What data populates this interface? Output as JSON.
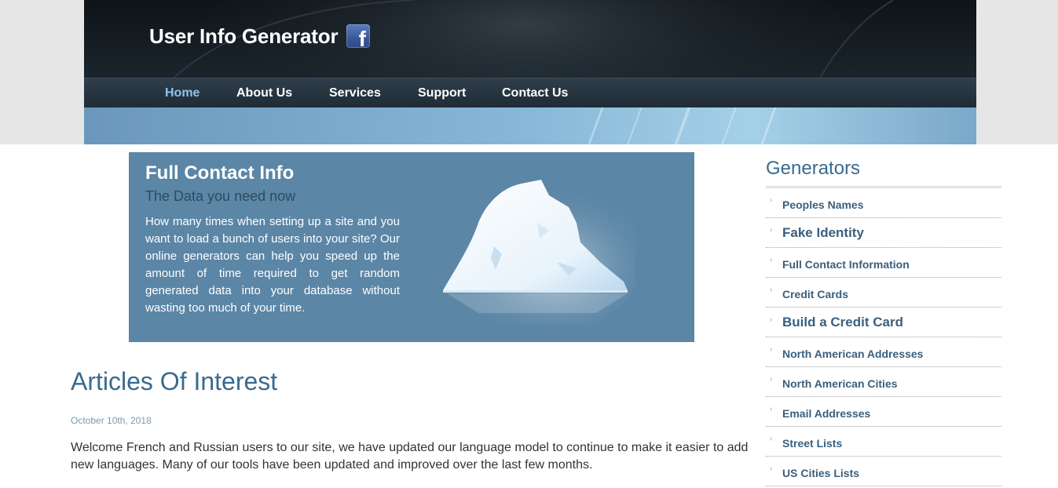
{
  "header": {
    "site_title": "User Info Generator",
    "social_icon": "facebook-icon",
    "nav": [
      {
        "label": "Home",
        "active": true
      },
      {
        "label": "About Us",
        "active": false
      },
      {
        "label": "Services",
        "active": false
      },
      {
        "label": "Support",
        "active": false
      },
      {
        "label": "Contact Us",
        "active": false
      }
    ]
  },
  "feature": {
    "title": "Full Contact Info",
    "subtitle": "The Data you need now",
    "body": "How many times when setting up a site and you want to load a bunch of users into your site? Our online generators can help you speed up the amount of time required to get random generated data into your database without wasting too much of your time."
  },
  "articles": {
    "heading": "Articles Of Interest",
    "date": "October 10th, 2018",
    "body": "Welcome French and Russian users to our site, we have updated our language model to continue to make it easier to add new languages. Many of our tools have been updated and improved over the last few months."
  },
  "sidebar": {
    "heading": "Generators",
    "items": [
      {
        "label": "Peoples Names",
        "large": false
      },
      {
        "label": "Fake Identity",
        "large": true
      },
      {
        "label": "Full Contact Information",
        "large": false
      },
      {
        "label": "Credit Cards",
        "large": false
      },
      {
        "label": "Build a Credit Card",
        "large": true
      },
      {
        "label": "North American Addresses",
        "large": false
      },
      {
        "label": "North American Cities",
        "large": false
      },
      {
        "label": "Email Addresses",
        "large": false
      },
      {
        "label": "Street Lists",
        "large": false
      },
      {
        "label": "US Cities Lists",
        "large": false
      }
    ]
  },
  "colors": {
    "accent": "#3a6a8e",
    "nav_active": "#8fc5ec",
    "feature_bg": "#5b86a6",
    "header_dark": "#121a20"
  }
}
